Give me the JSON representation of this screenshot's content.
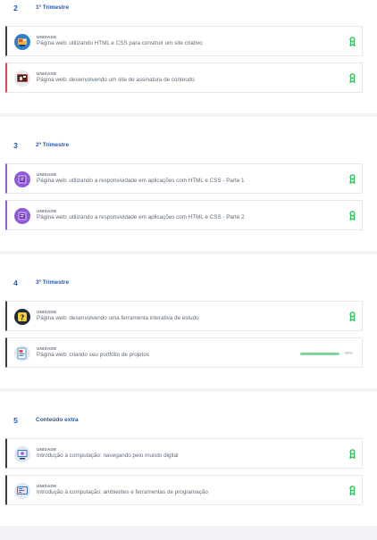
{
  "sections": [
    {
      "number": "2",
      "title": "1º Trimestre",
      "cards": [
        {
          "kind": "UNIDADE",
          "title": "Página web: utilizando HTML e CSS para construir um site criativo",
          "accent": "#3a3f46",
          "icon": "html-css-creative-site-icon",
          "completed": true
        },
        {
          "kind": "UNIDADE",
          "title": "Página web: desenvolvendo um site de assinatura de conteúdo",
          "accent": "#e24a4a",
          "icon": "subscription-site-icon",
          "completed": true
        }
      ]
    },
    {
      "number": "3",
      "title": "2º Trimestre",
      "cards": [
        {
          "kind": "UNIDADE",
          "title": "Página web: utilizando a responsividade em aplicações com HTML e CSS - Parte 1",
          "accent": "#9b59d0",
          "icon": "responsive-html-css-icon",
          "completed": true
        },
        {
          "kind": "UNIDADE",
          "title": "Página web: utilizando a responsividade em aplicações com HTML e CSS - Parte 2",
          "accent": "#9b59d0",
          "icon": "responsive-html-css-icon",
          "completed": true
        }
      ]
    },
    {
      "number": "4",
      "title": "3º Trimestre",
      "cards": [
        {
          "kind": "UNIDADE",
          "title": "Página web: desenvolvendo uma ferramenta interativa de estudo",
          "accent": "#3a3f46",
          "icon": "interactive-study-tool-icon",
          "completed": true
        },
        {
          "kind": "UNIDADE",
          "title": "Página web: criando seu portfólio de projetos",
          "accent": "#3a3f46",
          "icon": "portfolio-icon",
          "completed": false,
          "progress_percent": 99,
          "progress_label": "99%"
        }
      ]
    },
    {
      "number": "5",
      "title": "Conteúdo extra",
      "cards": [
        {
          "kind": "UNIDADE",
          "title": "Introdução à computação: navegando pelo mundo digital",
          "accent": "#3a3f46",
          "icon": "digital-world-icon",
          "completed": true
        },
        {
          "kind": "UNIDADE",
          "title": "Introdução à computação: ambientes e ferramentas de programação",
          "accent": "#3a3f46",
          "icon": "programming-tools-icon",
          "completed": true
        }
      ]
    }
  ],
  "colors": {
    "section_title": "#2a56a6",
    "badge_green": "#2fbf5a",
    "progress_fill": "#7fd69b",
    "card_border": "#e4e7ec",
    "page_background": "#f1f3f6"
  }
}
